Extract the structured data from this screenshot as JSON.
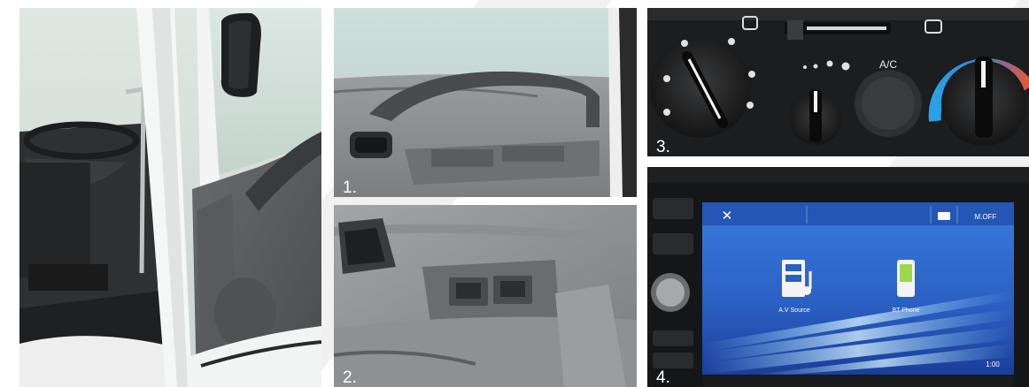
{
  "captions": {
    "p1": "1.",
    "p2": "2.",
    "p3": "3.",
    "p4": "4."
  },
  "ac_panel": {
    "ac_button_label": "A/C"
  },
  "head_unit": {
    "close_symbol": "✕",
    "mute_label": "M.OFF",
    "app_av": "A.V Source",
    "app_bt": "BT Phone",
    "clock": "1:00"
  },
  "colors": {
    "cab_door": "#5d5e60",
    "door_trim": "#8a8c8e",
    "screen_blue": "#2f6fce",
    "hot_red": "#e8563a",
    "cold_blue": "#2aa0e6"
  }
}
